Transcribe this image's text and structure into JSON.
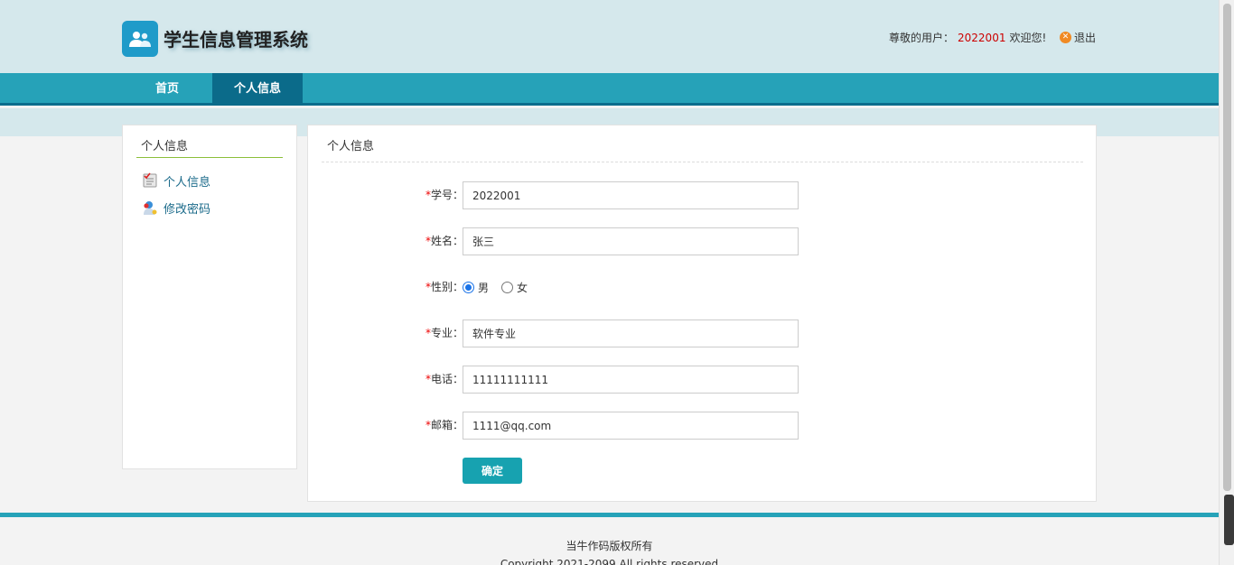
{
  "header": {
    "title": "学生信息管理系统",
    "greeting_prefix": "尊敬的用户：",
    "user_id": "2022001",
    "greeting_suffix": "欢迎您!",
    "logout_label": "退出",
    "logo_icon": "users-icon",
    "logout_icon": "close-circle-icon"
  },
  "nav": {
    "items": [
      {
        "label": "首页",
        "active": false
      },
      {
        "label": "个人信息",
        "active": true
      }
    ]
  },
  "sidebar": {
    "title": "个人信息",
    "items": [
      {
        "label": "个人信息",
        "icon": "document-icon"
      },
      {
        "label": "修改密码",
        "icon": "user-key-icon"
      }
    ]
  },
  "main": {
    "title": "个人信息",
    "form": {
      "student_id": {
        "label": "学号：",
        "value": "2022001"
      },
      "name": {
        "label": "姓名：",
        "value": "张三"
      },
      "gender": {
        "label": "性别：",
        "options": [
          "男",
          "女"
        ],
        "selected": "男"
      },
      "major": {
        "label": "专业：",
        "value": "软件专业"
      },
      "phone": {
        "label": "电话：",
        "value": "11111111111"
      },
      "email": {
        "label": "邮箱：",
        "value": "1111@qq.com"
      },
      "required_mark": "*",
      "submit_label": "确定"
    }
  },
  "footer": {
    "line1": "当牛作码版权所有",
    "line2": "Copyright 2021-2099 All rights reserved"
  },
  "colors": {
    "header_bg": "#d5e8ec",
    "nav_bg": "#26a2b8",
    "nav_active": "#0b6b8a",
    "button": "#17a2b0",
    "required": "#e00000",
    "user_id": "#cc0000"
  }
}
